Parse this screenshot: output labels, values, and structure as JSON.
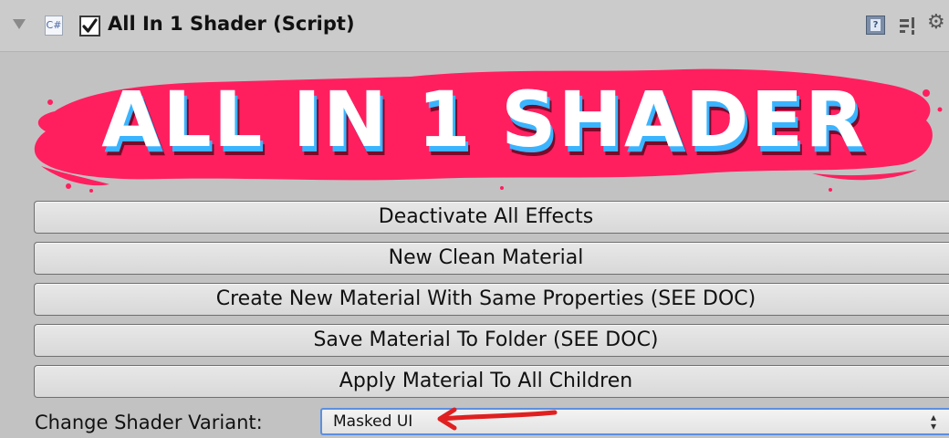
{
  "component": {
    "icon": "csharp-script-icon",
    "icon_text": "C#",
    "enabled": true,
    "title": "All In 1 Shader (Script)"
  },
  "banner": {
    "text": "ALL IN 1 SHADER",
    "colors": {
      "splash": "#ff1f5f",
      "text": "#ffffff",
      "shadow_blue": "#3ab4ff",
      "shadow_dark": "#7a0a2a"
    }
  },
  "buttons": [
    {
      "label": "Deactivate All Effects"
    },
    {
      "label": "New Clean Material"
    },
    {
      "label": "Create New Material With Same Properties (SEE DOC)"
    },
    {
      "label": "Save Material To Folder (SEE DOC)"
    },
    {
      "label": "Apply Material To All Children"
    }
  ],
  "shader_variant": {
    "label": "Change Shader Variant:",
    "selected": "Masked UI"
  },
  "colors": {
    "panel_bg": "#c2c2c2",
    "focus_blue": "#5c8fe0",
    "annotation_red": "#e02020"
  },
  "icons": [
    "foldout-arrow-icon",
    "csharp-script-icon",
    "checkbox-icon",
    "help-book-icon",
    "preset-icon",
    "gear-icon",
    "red-arrow-annotation"
  ]
}
